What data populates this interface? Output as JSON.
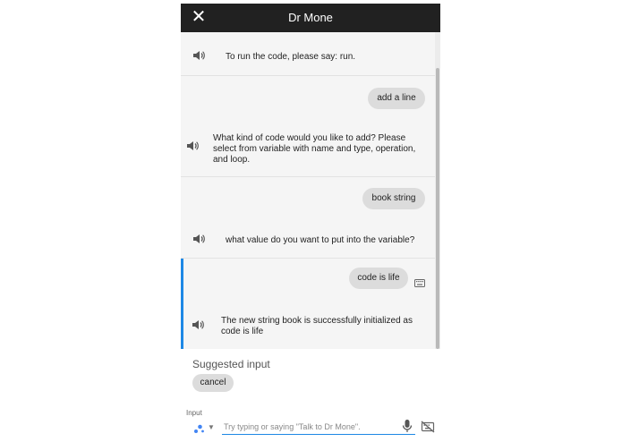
{
  "titlebar": {
    "title": "Dr Mone",
    "close_icon": "close-icon"
  },
  "conversation": [
    {
      "assistant": "To run the code, please say: run."
    },
    {
      "user": "add a line",
      "assistant": "What kind of code would you like to add? Please select from variable with name and type, operation, and loop."
    },
    {
      "user": "book string",
      "assistant": "what value do you want to put into the variable?"
    },
    {
      "user": "code is life",
      "input_mode_icon": "keyboard-icon",
      "assistant": "The new string book is successfully initialized as code is life"
    }
  ],
  "suggestions": {
    "label": "Suggested input",
    "chips": [
      "cancel"
    ]
  },
  "input": {
    "label": "Input",
    "placeholder": "Try typing or saying \"Talk to Dr Mone\".",
    "value": "",
    "assistant_icon": "assistant-dots-icon",
    "mic_icon": "microphone-icon",
    "keyboard_icon": "keyboard-off-icon"
  },
  "colors": {
    "titlebar": "#212121",
    "accent": "#1e88e5",
    "bubble": "#dcdcdc",
    "chat_bg": "#f5f5f5"
  }
}
